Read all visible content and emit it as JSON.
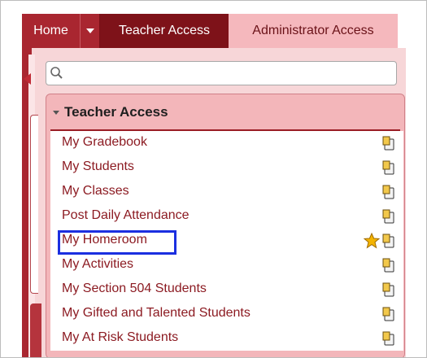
{
  "nav": {
    "home_label": "Home",
    "teacher_label": "Teacher Access",
    "admin_label": "Administrator Access"
  },
  "search": {
    "placeholder": ""
  },
  "panel": {
    "title": "Teacher Access",
    "items": [
      {
        "label": "My Gradebook",
        "favorite": false
      },
      {
        "label": "My Students",
        "favorite": false
      },
      {
        "label": "My Classes",
        "favorite": false
      },
      {
        "label": "Post Daily Attendance",
        "favorite": false
      },
      {
        "label": "My Homeroom",
        "favorite": true,
        "highlighted": true
      },
      {
        "label": "My Activities",
        "favorite": false
      },
      {
        "label": "My Section 504 Students",
        "favorite": false
      },
      {
        "label": "My Gifted and Talented Students",
        "favorite": false
      },
      {
        "label": "My At Risk Students",
        "favorite": false
      }
    ]
  },
  "colors": {
    "nav_bg": "#a92630",
    "nav_active": "#7e1219",
    "nav_inactive": "#f5b8bd",
    "link": "#8c1b22",
    "highlight": "#1b2fe0",
    "star": "#f4b400"
  },
  "icons": {
    "search": "search-icon",
    "item_action": "clipboard-icon",
    "favorite": "star-icon"
  }
}
